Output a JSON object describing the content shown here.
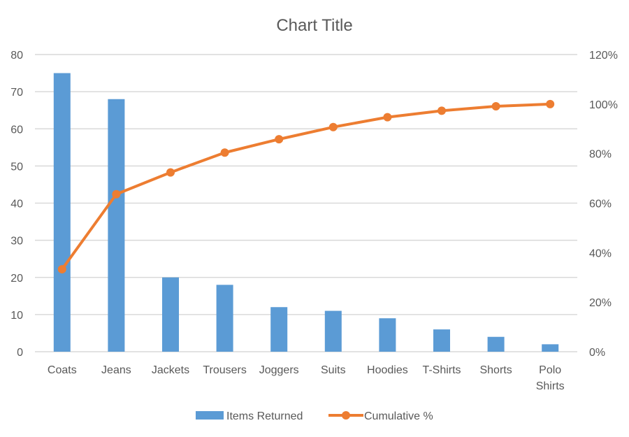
{
  "chart_data": {
    "type": "bar",
    "combo": "bar+line (pareto)",
    "title": "Chart Title",
    "categories": [
      "Coats",
      "Jeans",
      "Jackets",
      "Trousers",
      "Joggers",
      "Suits",
      "Hoodies",
      "T-Shirts",
      "Shorts",
      "Polo Shirts"
    ],
    "category_label_lines": [
      [
        "Coats"
      ],
      [
        "Jeans"
      ],
      [
        "Jackets"
      ],
      [
        "Trousers"
      ],
      [
        "Joggers"
      ],
      [
        "Suits"
      ],
      [
        "Hoodies"
      ],
      [
        "T-Shirts"
      ],
      [
        "Shorts"
      ],
      [
        "Polo",
        "Shirts"
      ]
    ],
    "series": [
      {
        "name": "Items Returned",
        "type": "bar",
        "axis": "left",
        "color": "#5B9BD5",
        "values": [
          75,
          68,
          20,
          18,
          12,
          11,
          9,
          6,
          4,
          2
        ]
      },
      {
        "name": "Cumulative %",
        "type": "line",
        "axis": "right",
        "color": "#ED7D31",
        "markers": true,
        "values": [
          33.3,
          63.6,
          72.4,
          80.4,
          85.8,
          90.7,
          94.7,
          97.3,
          99.1,
          100.0
        ]
      }
    ],
    "left_axis": {
      "min": 0,
      "max": 80,
      "step": 10,
      "ticks": [
        "0",
        "10",
        "20",
        "30",
        "40",
        "50",
        "60",
        "70",
        "80"
      ]
    },
    "right_axis": {
      "min": 0,
      "max": 120,
      "step": 20,
      "ticks": [
        "0%",
        "20%",
        "40%",
        "60%",
        "80%",
        "100%",
        "120%"
      ]
    },
    "xlabel": "",
    "ylabel": "",
    "grid": true,
    "gridline_color": "#D9D9D9",
    "legend_position": "bottom"
  }
}
